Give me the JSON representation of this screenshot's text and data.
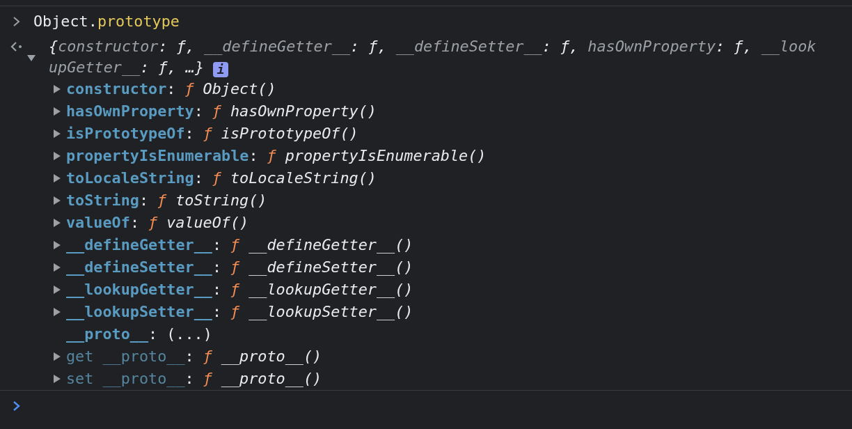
{
  "console": {
    "input": {
      "object": "Object",
      "dot": ".",
      "property": "prototype"
    },
    "result": {
      "expanded": true,
      "open_brace": "{",
      "close_brace": "}",
      "ellipsis": "…",
      "info_badge": "i",
      "summary": [
        {
          "key": "constructor",
          "colon": ":",
          "value": "ƒ",
          "comma": ","
        },
        {
          "key": "__defineGetter__",
          "colon": ":",
          "value": "ƒ",
          "comma": ","
        },
        {
          "key": "__defineSetter__",
          "colon": ":",
          "value": "ƒ",
          "comma": ","
        },
        {
          "key": "hasOwnProperty",
          "colon": ":",
          "value": "ƒ",
          "comma": ","
        },
        {
          "key": "__lookupGetter__",
          "colon": ":",
          "value": "ƒ",
          "comma": ","
        }
      ],
      "properties": [
        {
          "kind": "function",
          "name": "constructor",
          "colon": ":",
          "sign": "ƒ",
          "value": "Object()",
          "accessor": false,
          "expanded": false
        },
        {
          "kind": "function",
          "name": "hasOwnProperty",
          "colon": ":",
          "sign": "ƒ",
          "value": "hasOwnProperty()",
          "accessor": false,
          "expanded": false
        },
        {
          "kind": "function",
          "name": "isPrototypeOf",
          "colon": ":",
          "sign": "ƒ",
          "value": "isPrototypeOf()",
          "accessor": false,
          "expanded": false
        },
        {
          "kind": "function",
          "name": "propertyIsEnumerable",
          "colon": ":",
          "sign": "ƒ",
          "value": "propertyIsEnumerable()",
          "accessor": false,
          "expanded": false
        },
        {
          "kind": "function",
          "name": "toLocaleString",
          "colon": ":",
          "sign": "ƒ",
          "value": "toLocaleString()",
          "accessor": false,
          "expanded": false
        },
        {
          "kind": "function",
          "name": "toString",
          "colon": ":",
          "sign": "ƒ",
          "value": "toString()",
          "accessor": false,
          "expanded": false
        },
        {
          "kind": "function",
          "name": "valueOf",
          "colon": ":",
          "sign": "ƒ",
          "value": "valueOf()",
          "accessor": false,
          "expanded": false
        },
        {
          "kind": "function",
          "name": "__defineGetter__",
          "colon": ":",
          "sign": "ƒ",
          "value": "__defineGetter__()",
          "accessor": false,
          "expanded": false
        },
        {
          "kind": "function",
          "name": "__defineSetter__",
          "colon": ":",
          "sign": "ƒ",
          "value": "__defineSetter__()",
          "accessor": false,
          "expanded": false
        },
        {
          "kind": "function",
          "name": "__lookupGetter__",
          "colon": ":",
          "sign": "ƒ",
          "value": "__lookupGetter__()",
          "accessor": false,
          "expanded": false
        },
        {
          "kind": "function",
          "name": "__lookupSetter__",
          "colon": ":",
          "sign": "ƒ",
          "value": "__lookupSetter__()",
          "accessor": false,
          "expanded": false
        },
        {
          "kind": "lazy",
          "name": "__proto__",
          "colon": ":",
          "value": "(...)",
          "accessor": false
        },
        {
          "kind": "function",
          "name": "get __proto__",
          "colon": ":",
          "sign": "ƒ",
          "value": "__proto__()",
          "accessor": true,
          "expanded": false
        },
        {
          "kind": "function",
          "name": "set __proto__",
          "colon": ":",
          "sign": "ƒ",
          "value": "__proto__()",
          "accessor": true,
          "expanded": false
        }
      ]
    }
  }
}
